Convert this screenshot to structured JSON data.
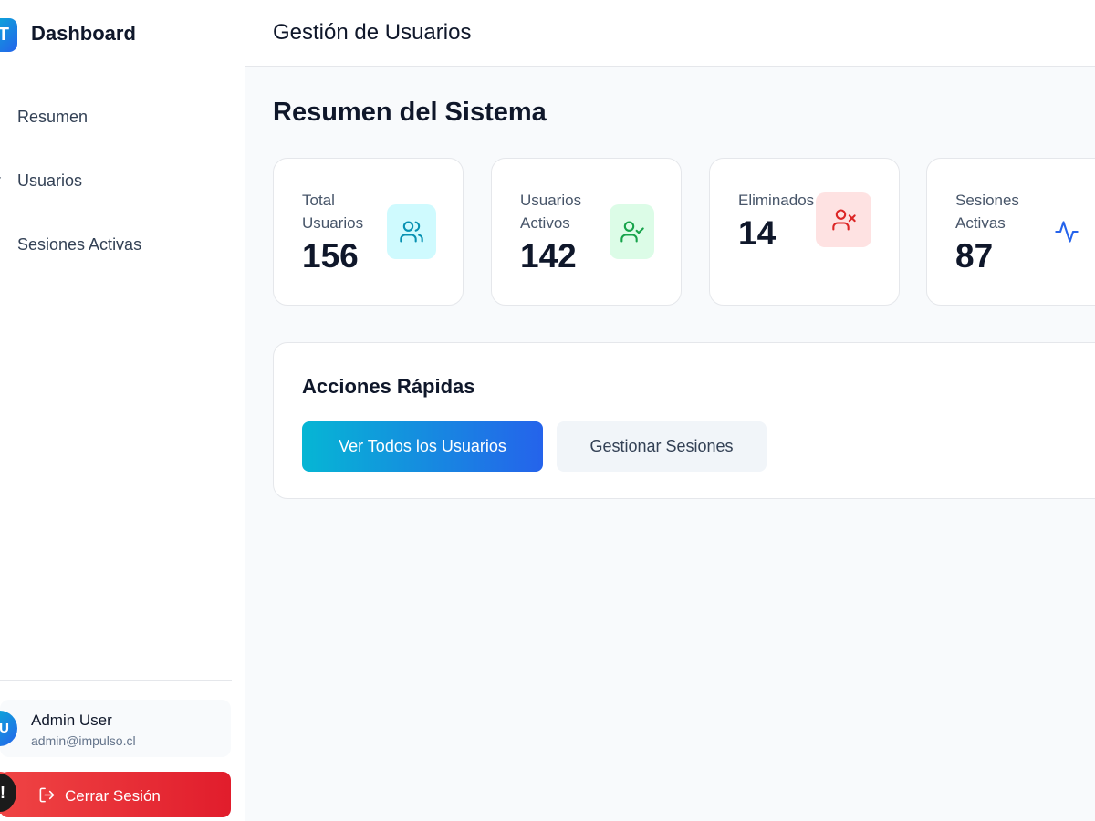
{
  "sidebar": {
    "brand_initial": "T",
    "brand_title": "Dashboard",
    "items": [
      {
        "label": "Resumen",
        "icon": "dashboard-icon"
      },
      {
        "label": "Usuarios",
        "icon": "user-icon"
      },
      {
        "label": "Sesiones Activas",
        "icon": "activity-icon"
      }
    ],
    "user": {
      "initials": "U",
      "name": "Admin User",
      "email": "admin@impulso.cl"
    },
    "logout_label": "Cerrar Sesión",
    "fab_label": "!"
  },
  "header": {
    "title": "Gestión de Usuarios"
  },
  "main": {
    "section_title": "Resumen del Sistema",
    "stats": [
      {
        "label": "Total Usuarios",
        "value": "156",
        "icon": "users-icon",
        "icon_bg": "#cffafe",
        "icon_color": "#0891b2"
      },
      {
        "label": "Usuarios Activos",
        "value": "142",
        "icon": "user-check-icon",
        "icon_bg": "#dcfce7",
        "icon_color": "#16a34a"
      },
      {
        "label": "Eliminados",
        "value": "14",
        "icon": "user-x-icon",
        "icon_bg": "#fee2e2",
        "icon_color": "#dc2626"
      },
      {
        "label": "Sesiones Activas",
        "value": "87",
        "icon": "activity-icon",
        "icon_bg": "#ffffff",
        "icon_color": "#2563eb"
      }
    ],
    "quick_actions": {
      "title": "Acciones Rápidas",
      "primary_label": "Ver Todos los Usuarios",
      "secondary_label": "Gestionar Sesiones"
    }
  },
  "colors": {
    "accent_start": "#06b6d4",
    "accent_end": "#2563eb",
    "danger": "#ef4444"
  }
}
